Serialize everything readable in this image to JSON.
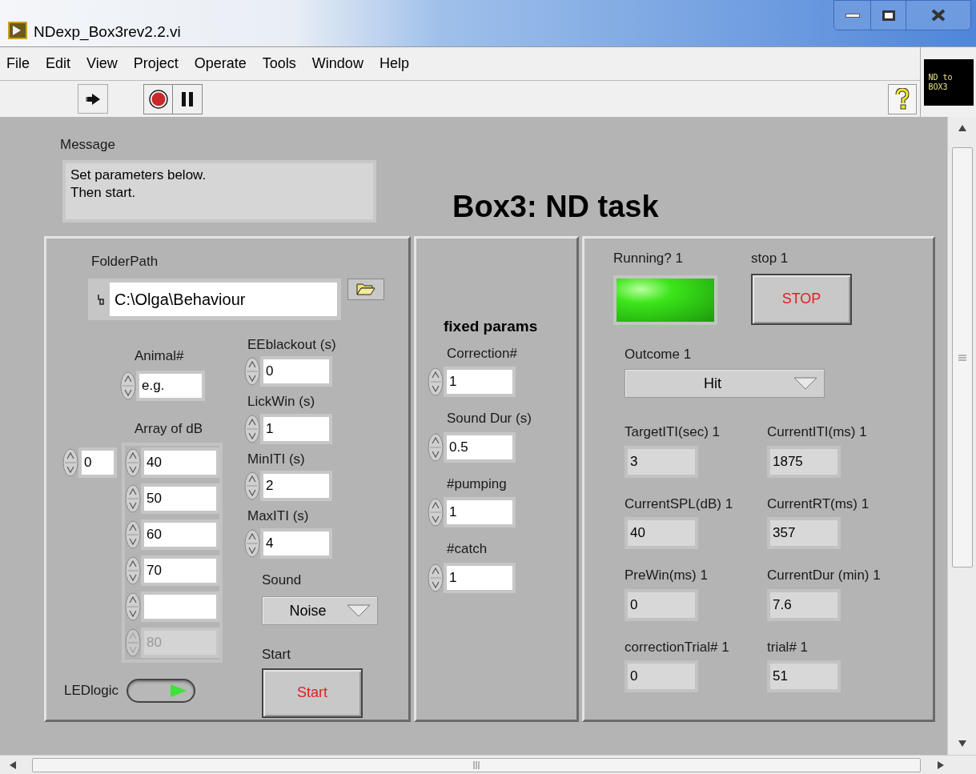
{
  "window": {
    "title": "NDexp_Box3rev2.2.vi"
  },
  "menu": [
    "File",
    "Edit",
    "View",
    "Project",
    "Operate",
    "Tools",
    "Window",
    "Help"
  ],
  "logo": {
    "lines": [
      "ND to",
      "BOX3"
    ]
  },
  "message": {
    "label": "Message",
    "lines": [
      "Set parameters below.",
      "Then start."
    ]
  },
  "heading": "Box3: ND task",
  "left_panel": {
    "folder_path": {
      "label": "FolderPath",
      "value": "C:\\Olga\\Behaviour"
    },
    "animal": {
      "label": "Animal#",
      "value": "e.g."
    },
    "array": {
      "label": "Array of dB",
      "index": "0",
      "items": [
        {
          "value": "40",
          "disabled": false
        },
        {
          "value": "50",
          "disabled": false
        },
        {
          "value": "60",
          "disabled": false
        },
        {
          "value": "70",
          "disabled": false
        },
        {
          "disabled": false
        },
        {
          "value": "80",
          "disabled": true
        }
      ]
    },
    "params": [
      {
        "label": "EEblackout (s)",
        "value": "0"
      },
      {
        "label": "LickWin (s)",
        "value": "1"
      },
      {
        "label": "MinITI (s)",
        "value": "2"
      },
      {
        "label": "MaxITI (s)",
        "value": "4"
      }
    ],
    "sound": {
      "label": "Sound",
      "value": "Noise"
    },
    "start": {
      "label": "Start",
      "button": "Start"
    },
    "led_logic": {
      "label": "LEDlogic",
      "on": true
    }
  },
  "fixed_panel": {
    "title": "fixed params",
    "params": [
      {
        "label": "Correction#",
        "value": "1"
      },
      {
        "label": "Sound Dur (s)",
        "value": "0.5"
      },
      {
        "label": "#pumping",
        "value": "1"
      },
      {
        "label": "#catch",
        "value": "1"
      }
    ]
  },
  "status_panel": {
    "running": {
      "label": "Running? 1",
      "on": true
    },
    "stop": {
      "label": "stop 1",
      "button": "STOP"
    },
    "outcome": {
      "label": "Outcome 1",
      "value": "Hit"
    },
    "indicators": [
      {
        "label": "TargetITI(sec) 1",
        "value": "3"
      },
      {
        "label": "CurrentITI(ms) 1",
        "value": "1875"
      },
      {
        "label": "CurrentSPL(dB) 1",
        "value": "40"
      },
      {
        "label": "CurrentRT(ms) 1",
        "value": "357"
      },
      {
        "label": "PreWin(ms) 1",
        "value": "0"
      },
      {
        "label": "CurrentDur (min) 1",
        "value": "7.6"
      },
      {
        "label": "correctionTrial# 1",
        "value": "0"
      },
      {
        "label": "trial# 1",
        "value": "51"
      }
    ]
  }
}
